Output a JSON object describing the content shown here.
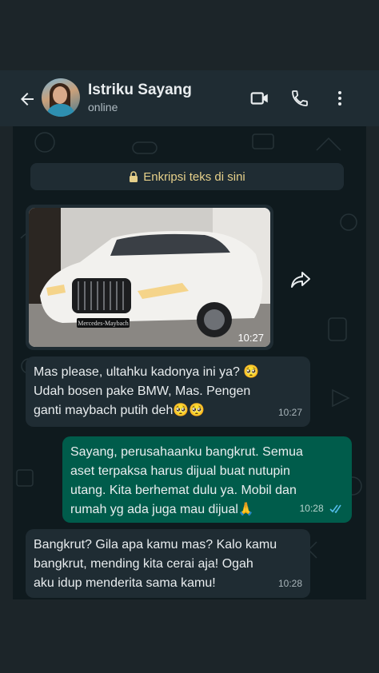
{
  "header": {
    "contact_name": "Istriku Sayang",
    "status": "online",
    "icons": [
      "back-arrow-icon",
      "video-call-icon",
      "phone-icon",
      "more-vert-icon"
    ]
  },
  "chat": {
    "encryption_notice": "Enkripsi teks di sini",
    "image_message": {
      "time": "10:27",
      "caption_on_car": "Mercedes-Maybach"
    },
    "messages": [
      {
        "direction": "in",
        "text": "Mas please, ultahku kadonya ini ya? 🥺\nUdah bosen pake BMW, Mas. Pengen\nganti maybach putih deh🥺🥺",
        "time": "10:27"
      },
      {
        "direction": "out",
        "text": "Sayang, perusahaanku bangkrut. Semua\naset terpaksa harus dijual buat nutupin\nutang. Kita berhemat dulu ya. Mobil dan\nrumah yg ada juga mau dijual🙏",
        "time": "10:28",
        "read": true
      },
      {
        "direction": "in",
        "text": "Bangkrut? Gila apa kamu mas? Kalo kamu\nbangkrut, mending kita cerai aja! Ogah\naku idup menderita sama kamu!",
        "time": "10:28"
      }
    ]
  },
  "colors": {
    "header_bg": "#1f2c33",
    "incoming_bubble": "#1f2c33",
    "outgoing_bubble": "#005c4b",
    "read_tick": "#53bdeb",
    "encryption_text": "#e6d08a"
  }
}
